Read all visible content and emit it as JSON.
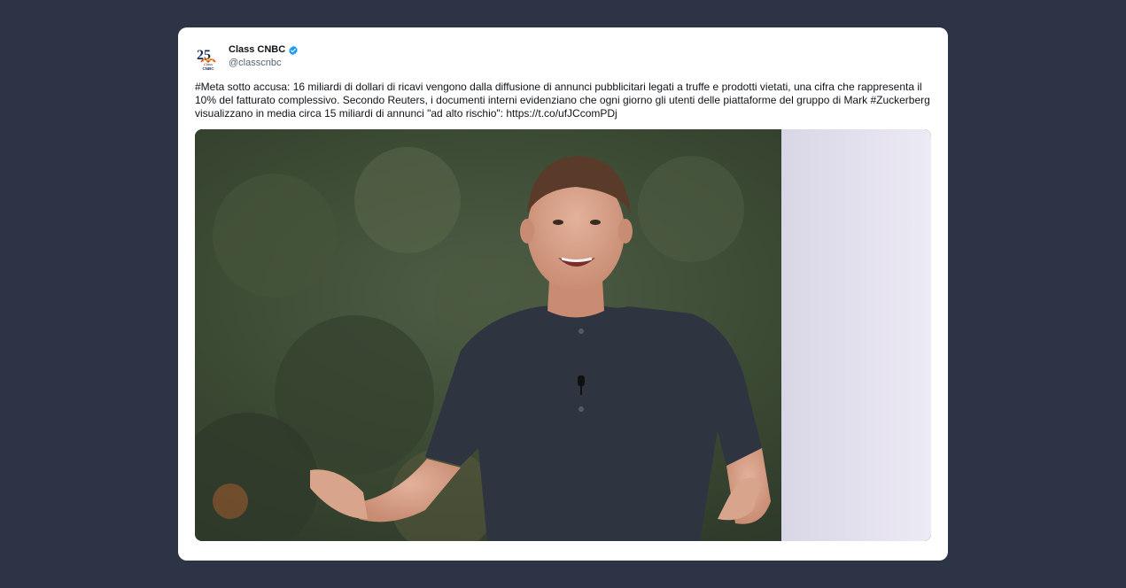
{
  "tweet": {
    "author_name": "Class CNBC",
    "author_handle": "@classcnbc",
    "verified": true,
    "avatar_text": "25",
    "avatar_subtext": "CNBC",
    "text": "#Meta sotto accusa: 16 miliardi di dollari di ricavi vengono dalla diffusione di annunci pubblicitari legati a truffe e prodotti vietati, una cifra che rappresenta il 10% del fatturato complessivo. Secondo Reuters, i documenti interni evidenziano che ogni giorno gli utenti delle piattaforme del gruppo di Mark #Zuckerberg visualizzano in media circa 15 miliardi di annunci \"ad alto rischio\": https://t.co/ufJCcomPDj"
  },
  "colors": {
    "page_background": "#2c3445",
    "card_background": "#ffffff",
    "verified_blue": "#1d9bf0",
    "text_primary": "#0f1419",
    "text_secondary": "#536471"
  },
  "media": {
    "icon": "photo-of-man-in-dark-tshirt"
  }
}
